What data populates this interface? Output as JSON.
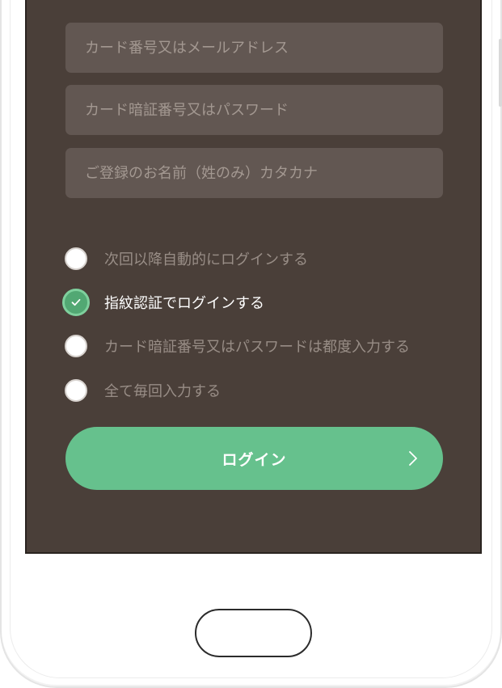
{
  "login_form": {
    "fields": [
      {
        "placeholder": "カード番号又はメールアドレス",
        "value": ""
      },
      {
        "placeholder": "カード暗証番号又はパスワード",
        "value": ""
      },
      {
        "placeholder": "ご登録のお名前（姓のみ）カタカナ",
        "value": ""
      }
    ],
    "options": [
      {
        "label": "次回以降自動的にログインする",
        "selected": false
      },
      {
        "label": "指紋認証でログインする",
        "selected": true
      },
      {
        "label": "カード暗証番号又はパスワードは都度入力する",
        "selected": false
      },
      {
        "label": "全て毎回入力する",
        "selected": false
      }
    ],
    "login_button_label": "ログイン"
  },
  "icons": {
    "selected_radio": "checkmark-icon",
    "login_button_arrow": "chevron-right-icon"
  },
  "colors": {
    "screen_background": "#4a3f39",
    "field_background": "#625752",
    "accent_green": "#66c18d",
    "selected_radio": "#52a873"
  }
}
